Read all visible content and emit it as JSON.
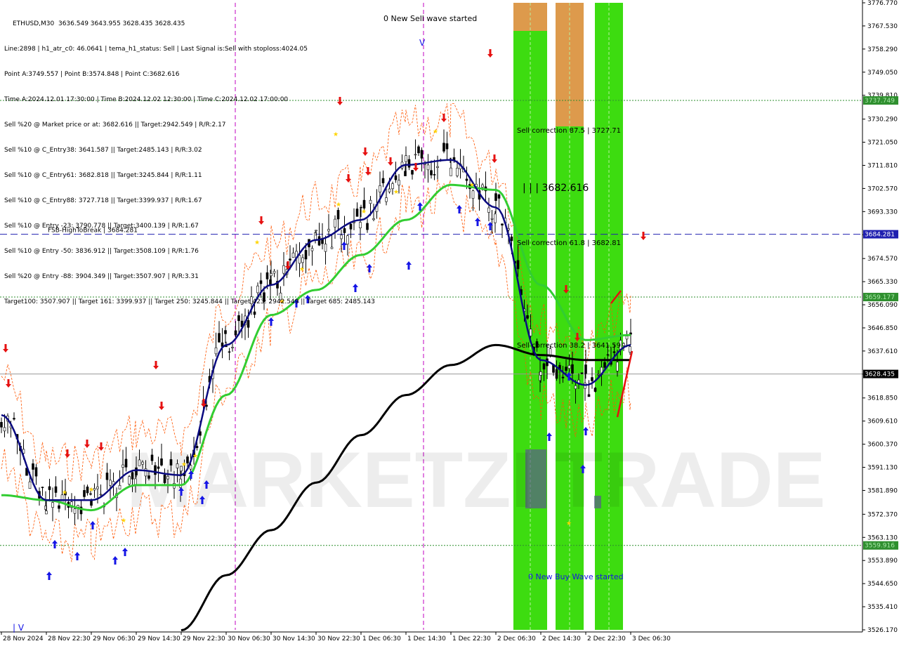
{
  "header": {
    "lines": [
      "ETHUSD,M30  3636.549 3643.955 3628.435 3628.435",
      "Line:2898 | h1_atr_c0: 46.0641 | tema_h1_status: Sell | Last Signal is:Sell with stoploss:4024.05",
      "Point A:3749.557 | Point B:3574.848 | Point C:3682.616",
      "Time A:2024.12.01 17:30:00 | Time B:2024.12.02 12:30:00 | Time C:2024.12.02 17:00:00",
      "Sell %20 @ Market price or at: 3682.616 || Target:2942.549 | R/R:2.17",
      "Sell %10 @ C_Entry38: 3641.587 || Target:2485.143 | R/R:3.02",
      "Sell %10 @ C_Entry61: 3682.818 || Target:3245.844 | R/R:1.11",
      "Sell %10 @ C_Entry88: 3727.718 || Target:3399.937 | R/R:1.67",
      "Sell %10 @ Entry -23: 3790.778 || Target:3400.139 | R/R:1.67",
      "Sell %10 @ Entry -50: 3836.912 || Target:3508.109 | R/R:1.76",
      "Sell %20 @ Entry -88: 3904.349 || Target:3507.907 | R/R:3.31"
    ],
    "targets_line": "Target100: 3507.907 || Target 161: 3399.937 || Target 250: 3245.844 || Target 423: 2942.549 || Target 685: 2485.143"
  },
  "annotations": {
    "sell_wave": "0 New Sell wave started",
    "buy_wave": "0 New Buy Wave started",
    "fsb_label": "FSB-HighToBreak | 3684.281",
    "point_c_label": "| | | 3682.616",
    "sell_corr_875": "Sell correction 87.5 | 3727.71",
    "sell_corr_618": "Sell correction 61.8 | 3682.81",
    "sell_corr_382": "Sell correction 38.2 | 3641.59",
    "sell_wave_marker": "V",
    "buy_wave_marker": "| V",
    "watermark": "MARKETZI TRADE"
  },
  "price_tags": {
    "current": "3628.435",
    "fsb": "3684.281",
    "upper_target": "3737.749",
    "mid_level": "3659.177",
    "lower_level": "3559.916"
  },
  "colors": {
    "up_arrow": "#1515e6",
    "down_arrow": "#e61010",
    "green_zone": "#3ddc10",
    "orange_zone": "#dd9a4c",
    "fsb_line": "#2020b0",
    "green_dotted": "#2f8f2f",
    "ma_fast": "#0a0a80",
    "ma_mid": "#32cd32",
    "ma_slow": "#000000",
    "envelope": "#ff5500"
  },
  "chart_data": {
    "type": "line",
    "symbol": "ETHUSD",
    "timeframe": "M30",
    "ohlc_last": {
      "open": 3636.549,
      "high": 3643.955,
      "low": 3628.435,
      "close": 3628.435
    },
    "ylim": [
      3526.17,
      3776.77
    ],
    "y_ticks": [
      3776.77,
      3767.53,
      3758.29,
      3749.05,
      3739.81,
      3730.29,
      3721.05,
      3711.81,
      3702.57,
      3693.33,
      3684.09,
      3674.57,
      3665.33,
      3656.09,
      3646.85,
      3637.61,
      3628.37,
      3618.85,
      3609.61,
      3600.37,
      3591.13,
      3581.89,
      3572.37,
      3563.13,
      3553.89,
      3544.65,
      3535.41,
      3526.17
    ],
    "x_tick_labels": [
      "28 Nov 2024",
      "28 Nov 22:30",
      "29 Nov 06:30",
      "29 Nov 14:30",
      "29 Nov 22:30",
      "30 Nov 06:30",
      "30 Nov 14:30",
      "30 Nov 22:30",
      "1 Dec 06:30",
      "1 Dec 14:30",
      "1 Dec 22:30",
      "2 Dec 06:30",
      "2 Dec 14:30",
      "2 Dec 22:30",
      "3 Dec 06:30"
    ],
    "levels": {
      "fsb_high_to_break": 3684.281,
      "upper_target": 3737.749,
      "mid_level": 3659.177,
      "lower_level": 3559.916,
      "current_price": 3628.435
    },
    "series": [
      {
        "kind": "ma_fast",
        "x": [
          "28 Nov 2024",
          "28 Nov 22:30",
          "29 Nov 06:30",
          "29 Nov 14:30",
          "29 Nov 22:30",
          "30 Nov 06:30",
          "30 Nov 14:30",
          "30 Nov 22:30",
          "1 Dec 06:30",
          "1 Dec 14:30",
          "1 Dec 22:30",
          "2 Dec 06:30",
          "2 Dec 14:30",
          "2 Dec 22:30",
          "3 Dec 06:30"
        ],
        "values": [
          3612,
          3578,
          3578,
          3590,
          3588,
          3640,
          3664,
          3682,
          3690,
          3712,
          3714,
          3695,
          3634,
          3624,
          3640
        ]
      },
      {
        "kind": "ma_mid",
        "x": [
          "28 Nov 2024",
          "28 Nov 22:30",
          "29 Nov 06:30",
          "29 Nov 14:30",
          "29 Nov 22:30",
          "30 Nov 06:30",
          "30 Nov 14:30",
          "30 Nov 22:30",
          "1 Dec 06:30",
          "1 Dec 14:30",
          "1 Dec 22:30",
          "2 Dec 06:30",
          "2 Dec 14:30",
          "2 Dec 22:30",
          "3 Dec 06:30"
        ],
        "values": [
          3580,
          3578,
          3574,
          3584,
          3584,
          3620,
          3652,
          3662,
          3676,
          3690,
          3704,
          3702,
          3664,
          3642,
          3644
        ]
      },
      {
        "kind": "ma_slow",
        "x": [
          "29 Nov 22:30",
          "30 Nov 06:30",
          "30 Nov 14:30",
          "30 Nov 22:30",
          "1 Dec 06:30",
          "1 Dec 14:30",
          "1 Dec 22:30",
          "2 Dec 06:30",
          "2 Dec 14:30",
          "2 Dec 22:30",
          "3 Dec 06:30"
        ],
        "values": [
          3526,
          3548,
          3566,
          3585,
          3604,
          3620,
          3632,
          3640,
          3636,
          3634,
          3634
        ]
      }
    ]
  }
}
